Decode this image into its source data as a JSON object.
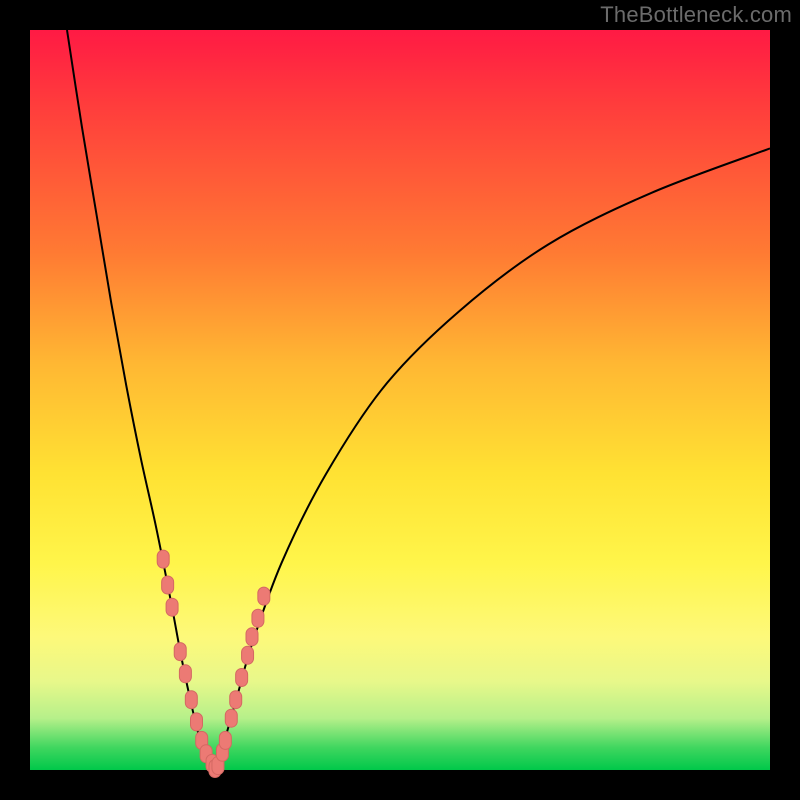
{
  "watermark": "TheBottleneck.com",
  "colors": {
    "frame": "#000000",
    "curve": "#000000",
    "marker": "#ec7a74",
    "gradient_top": "#ff1a44",
    "gradient_bottom": "#00c84a"
  },
  "chart_data": {
    "type": "line",
    "title": "",
    "xlabel": "",
    "ylabel": "",
    "xlim": [
      0,
      100
    ],
    "ylim": [
      0,
      100
    ],
    "series": [
      {
        "name": "left-branch",
        "x": [
          5,
          7,
          9,
          11,
          13,
          15,
          17,
          19,
          20.5,
          22,
          23,
          24,
          25
        ],
        "y": [
          100,
          87,
          75,
          63,
          52,
          42,
          33,
          23,
          15,
          8,
          4,
          1,
          0
        ]
      },
      {
        "name": "right-branch",
        "x": [
          25,
          26,
          28,
          30,
          34,
          40,
          48,
          58,
          70,
          84,
          100
        ],
        "y": [
          0,
          3,
          10,
          17,
          28,
          40,
          52,
          62,
          71,
          78,
          84
        ]
      }
    ],
    "markers": {
      "name": "sample-points",
      "points": [
        {
          "x": 18.0,
          "y": 28.5
        },
        {
          "x": 18.6,
          "y": 25.0
        },
        {
          "x": 19.2,
          "y": 22.0
        },
        {
          "x": 20.3,
          "y": 16.0
        },
        {
          "x": 21.0,
          "y": 13.0
        },
        {
          "x": 21.8,
          "y": 9.5
        },
        {
          "x": 22.5,
          "y": 6.5
        },
        {
          "x": 23.2,
          "y": 4.0
        },
        {
          "x": 23.8,
          "y": 2.2
        },
        {
          "x": 24.6,
          "y": 0.9
        },
        {
          "x": 25.0,
          "y": 0.2
        },
        {
          "x": 25.4,
          "y": 0.6
        },
        {
          "x": 26.0,
          "y": 2.4
        },
        {
          "x": 26.4,
          "y": 4.0
        },
        {
          "x": 27.2,
          "y": 7.0
        },
        {
          "x": 27.8,
          "y": 9.5
        },
        {
          "x": 28.6,
          "y": 12.5
        },
        {
          "x": 29.4,
          "y": 15.5
        },
        {
          "x": 30.0,
          "y": 18.0
        },
        {
          "x": 30.8,
          "y": 20.5
        },
        {
          "x": 31.6,
          "y": 23.5
        }
      ]
    }
  }
}
